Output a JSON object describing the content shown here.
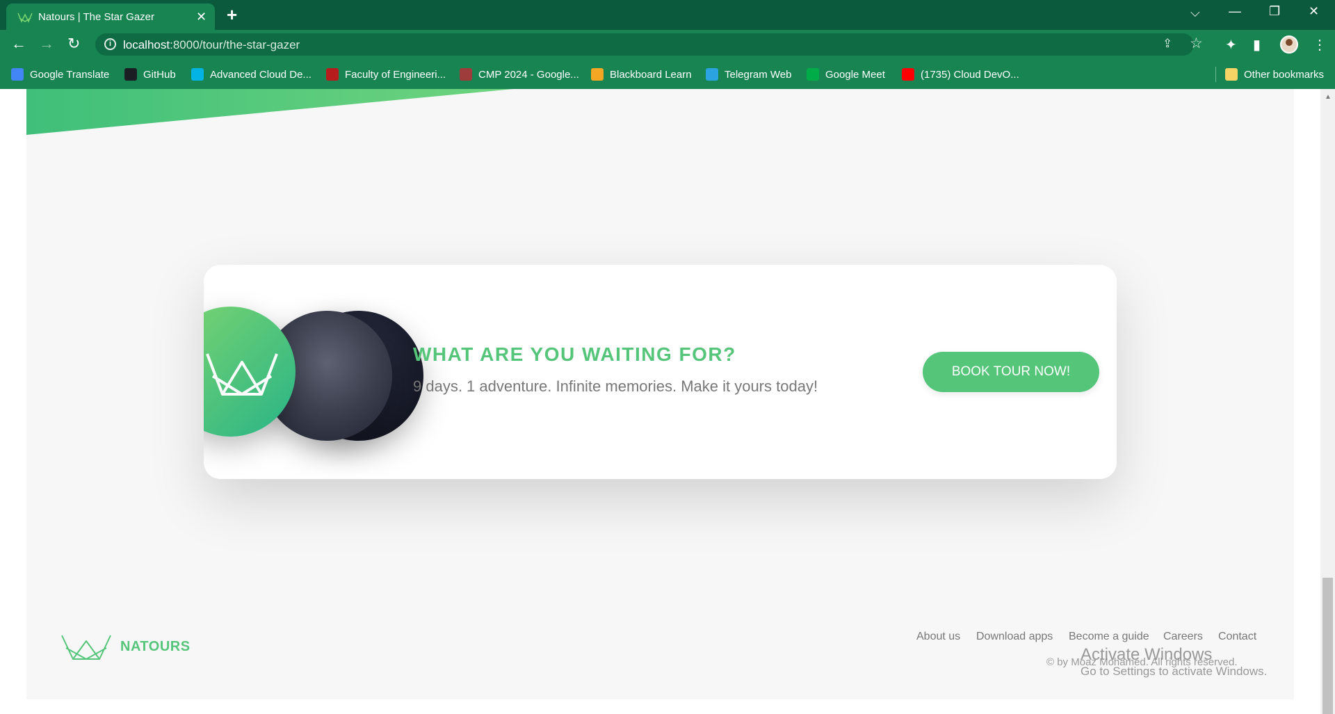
{
  "browser": {
    "tab_title": "Natours | The Star Gazer",
    "tab_close": "✕",
    "new_tab": "+",
    "window_controls": {
      "dropdown": "⌵",
      "minimize": "—",
      "restore": "❐",
      "close": "✕"
    },
    "nav": {
      "back": "←",
      "forward": "→",
      "reload": "↻"
    },
    "url_host": "localhost",
    "url_path": ":8000/tour/the-star-gazer",
    "info": "i",
    "bookmarks": [
      {
        "label": "Google Translate",
        "icon": "google-translate-icon",
        "color": "#4285f4"
      },
      {
        "label": "GitHub",
        "icon": "github-icon",
        "color": "#1b1f23"
      },
      {
        "label": "Advanced Cloud De...",
        "icon": "udacity-icon",
        "color": "#02b3e4"
      },
      {
        "label": "Faculty of Engineeri...",
        "icon": "faculty-icon",
        "color": "#b71c1c"
      },
      {
        "label": "CMP 2024 - Google...",
        "icon": "globe-icon",
        "color": "#9e3b3b"
      },
      {
        "label": "Blackboard Learn",
        "icon": "blackboard-icon",
        "color": "#f5a623"
      },
      {
        "label": "Telegram Web",
        "icon": "telegram-icon",
        "color": "#2aa3e0"
      },
      {
        "label": "Google Meet",
        "icon": "google-meet-icon",
        "color": "#00ac47"
      },
      {
        "label": "(1735) Cloud DevO...",
        "icon": "youtube-icon",
        "color": "#ff0000"
      }
    ],
    "other_bookmarks": "Other bookmarks"
  },
  "cta": {
    "heading": "WHAT ARE YOU WAITING FOR?",
    "text": "9 days. 1 adventure. Infinite memories. Make it yours today!",
    "button": "BOOK TOUR NOW!"
  },
  "footer": {
    "brand": "NATOURS",
    "links": [
      "About us",
      "Download apps",
      "Become a guide",
      "Careers",
      "Contact"
    ],
    "copyright": "© by Moaz Mohamed. All rights reserved."
  },
  "activate_windows": {
    "title": "Activate Windows",
    "subtitle": "Go to Settings to activate Windows."
  },
  "colors": {
    "brand_green": "#55c57a",
    "brand_green_dark": "#28b487",
    "chrome_dark": "#0b5a3e",
    "chrome": "#178451"
  }
}
